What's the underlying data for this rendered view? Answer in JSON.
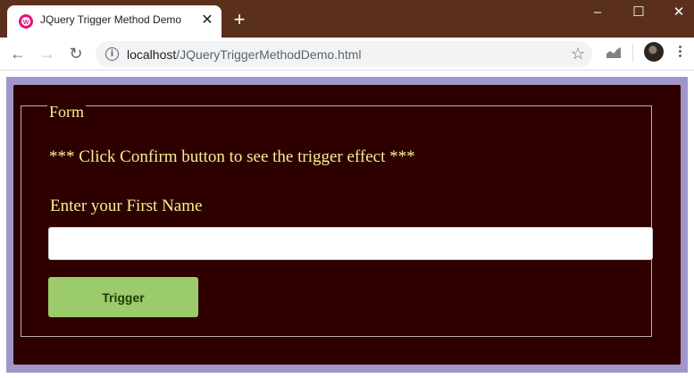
{
  "browser": {
    "tab_title": "JQuery Trigger Method Demo",
    "tab_close": "✕",
    "new_tab": "+",
    "url_host": "localhost",
    "url_path": "/JQueryTriggerMethodDemo.html",
    "window_controls": [
      "–",
      "☐",
      "✕"
    ],
    "colors": {
      "titlebar": "#5a301c"
    }
  },
  "page": {
    "legend": "Form",
    "message": "*** Click Confirm button to see the trigger effect ***",
    "first_name_label": "Enter your First Name",
    "first_name_value": "",
    "trigger_button": "Trigger",
    "colors": {
      "frame": "#9f97c9",
      "panel": "#2e0000",
      "text": "#f6f095",
      "button": "#9bcb6a"
    }
  }
}
